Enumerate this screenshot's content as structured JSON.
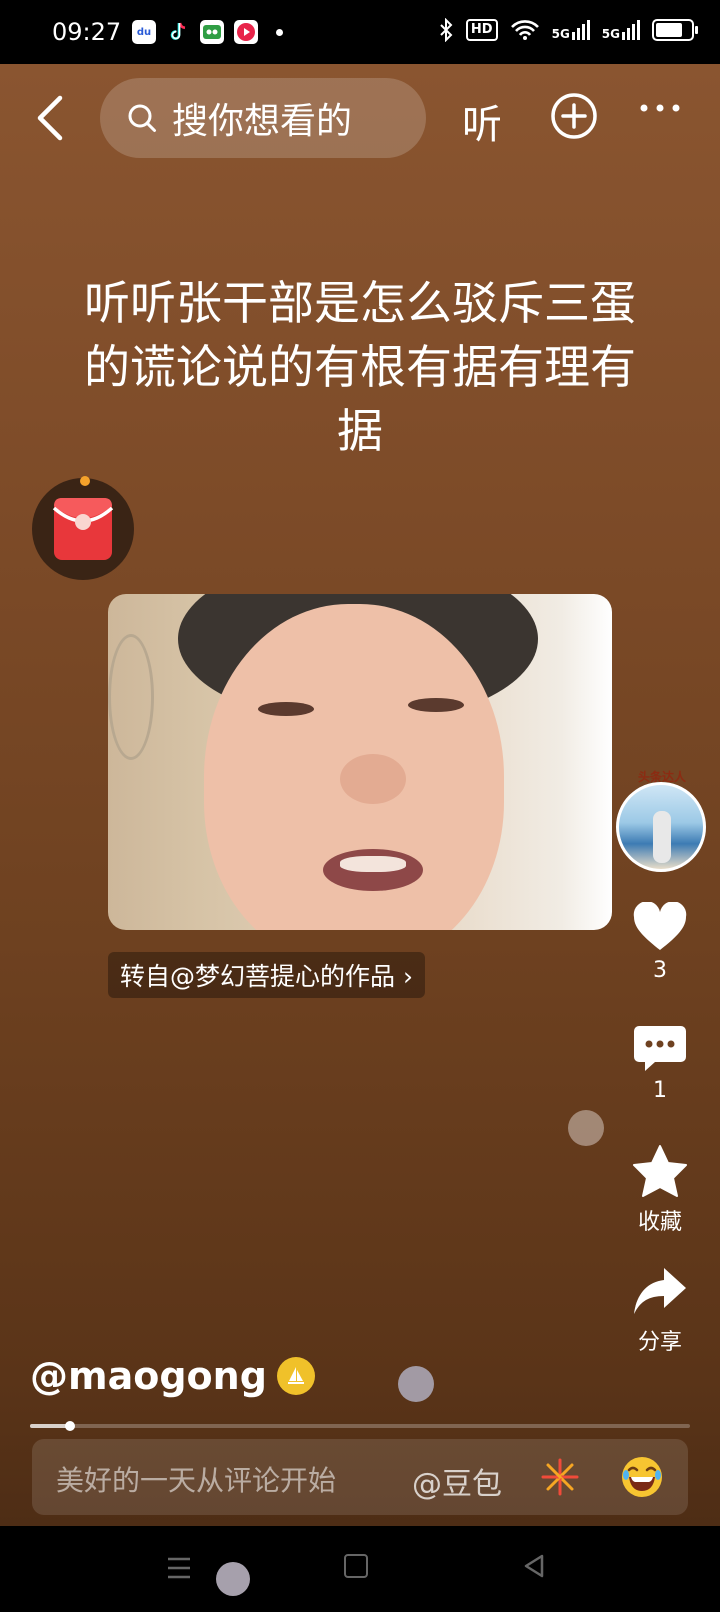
{
  "status_bar": {
    "time": "09:27",
    "hd_label": "HD",
    "network_1": "5G",
    "network_2": "5G",
    "battery_level": 0.75
  },
  "top_bar": {
    "search_placeholder": "搜你想看的",
    "listen_label": "听"
  },
  "post": {
    "title": "听听张干部是怎么驳斥三蛋的谎论说的有根有据有理有据",
    "source_tag": "转自@梦幻菩提心的作品 ›",
    "author": "@maogong"
  },
  "avatar_badge": "头条达人",
  "actions": {
    "like_count": "3",
    "comment_count": "1",
    "favorite_label": "收藏",
    "share_label": "分享"
  },
  "progress": 0.06,
  "comment_bar": {
    "placeholder": "美好的一天从评论开始",
    "mention": "@豆包"
  },
  "colors": {
    "background_top": "#8a5530",
    "background_bottom": "#4e2d15",
    "red_packet": "#e8373b",
    "author_badge": "#f0c12a"
  },
  "icons": [
    "back-arrow-icon",
    "search-icon",
    "plus-circle-icon",
    "more-dots-icon",
    "red-packet-icon",
    "heart-icon",
    "comment-icon",
    "star-icon",
    "share-arrow-icon",
    "firework-icon",
    "laugh-emoji-icon"
  ]
}
